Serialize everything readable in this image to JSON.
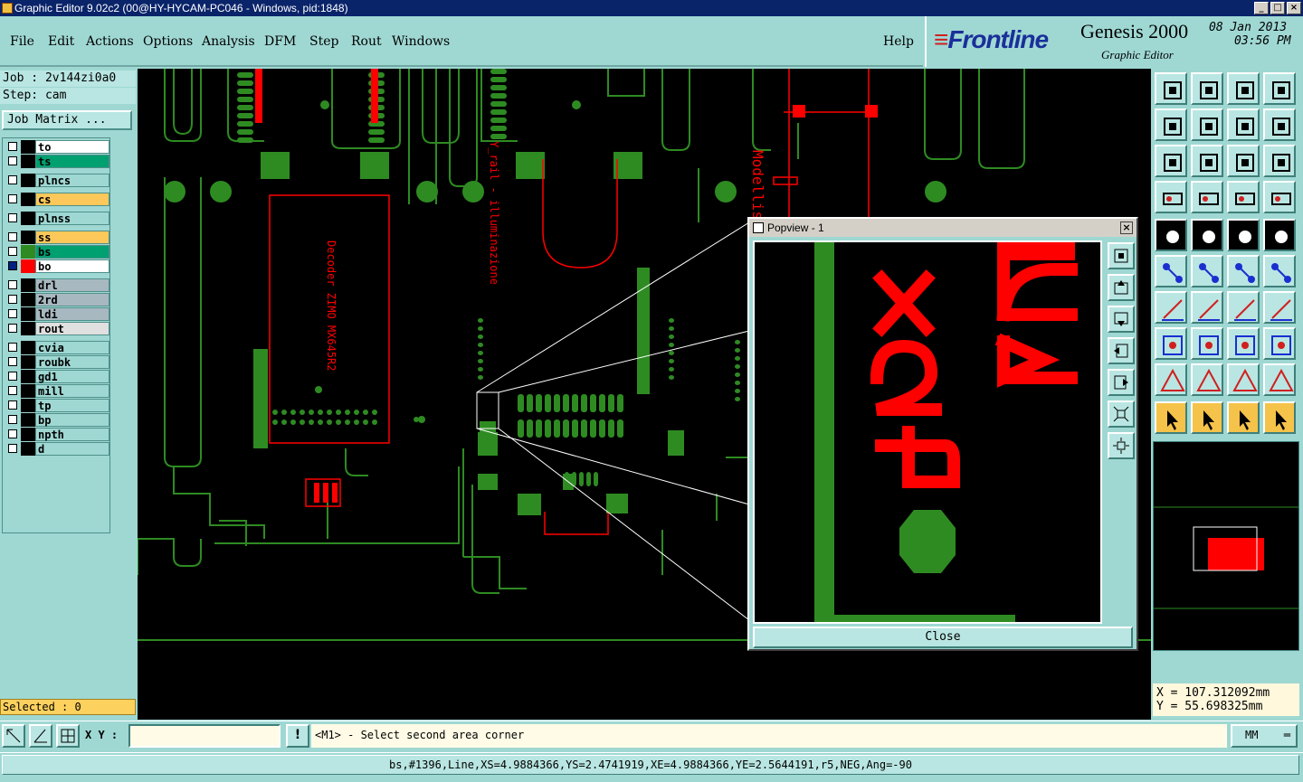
{
  "window": {
    "title": "Graphic Editor 9.02c2 (00@HY-HYCAM-PC046 - Windows, pid:1848)",
    "btn_min": "_",
    "btn_max": "□",
    "btn_close": "×"
  },
  "menu": {
    "items": [
      "File",
      "Edit",
      "Actions",
      "Options",
      "Analysis",
      "DFM",
      "Step",
      "Rout",
      "Windows"
    ],
    "help": "Help"
  },
  "brand": {
    "logo": "Frontline",
    "product": "Genesis 2000",
    "subtitle": "Graphic Editor",
    "date": "08 Jan 2013",
    "time": "03:56 PM"
  },
  "job": {
    "job_line": "Job : 2v144zi0a0",
    "step_line": "Step: cam",
    "matrix_button": "Job Matrix ..."
  },
  "layers": [
    {
      "name": "to",
      "color": "#ffffff",
      "swatch": "#000000",
      "checked": false
    },
    {
      "name": "ts",
      "color": "#00a070",
      "swatch": "#000000",
      "checked": false
    },
    {
      "name": "plncs",
      "color": "#9fd8d3",
      "swatch": "#000000",
      "checked": false
    },
    {
      "name": "cs",
      "color": "#fcc85a",
      "swatch": "#000000",
      "checked": false
    },
    {
      "name": "plnss",
      "color": "#9fd8d3",
      "swatch": "#000000",
      "checked": false
    },
    {
      "name": "ss",
      "color": "#fcc85a",
      "swatch": "#000000",
      "checked": false
    },
    {
      "name": "bs",
      "color": "#00a070",
      "swatch": "#2e8b22",
      "checked": false
    },
    {
      "name": "bo",
      "color": "#ffffff",
      "swatch": "#ff0000",
      "checked": true
    },
    {
      "name": "drl",
      "color": "#a8b8c0",
      "swatch": "#000000",
      "checked": false
    },
    {
      "name": "2rd",
      "color": "#a8b8c0",
      "swatch": "#000000",
      "checked": false
    },
    {
      "name": "ldi",
      "color": "#a8b8c0",
      "swatch": "#000000",
      "checked": false
    },
    {
      "name": "rout",
      "color": "#e0e0e0",
      "swatch": "#000000",
      "checked": false
    },
    {
      "name": "cvia",
      "color": "#9fd8d3",
      "swatch": "#000000",
      "checked": false
    },
    {
      "name": "roubk",
      "color": "#9fd8d3",
      "swatch": "#000000",
      "checked": false
    },
    {
      "name": "gd1",
      "color": "#9fd8d3",
      "swatch": "#000000",
      "checked": false
    },
    {
      "name": "mill",
      "color": "#9fd8d3",
      "swatch": "#000000",
      "checked": false
    },
    {
      "name": "tp",
      "color": "#9fd8d3",
      "swatch": "#000000",
      "checked": false
    },
    {
      "name": "bp",
      "color": "#9fd8d3",
      "swatch": "#000000",
      "checked": false
    },
    {
      "name": "npth",
      "color": "#9fd8d3",
      "swatch": "#000000",
      "checked": false
    },
    {
      "name": "d",
      "color": "#9fd8d3",
      "swatch": "#000000",
      "checked": false
    }
  ],
  "selected_label": "Selected : 0",
  "popview": {
    "title": "Popview - 1",
    "close_label": "Close",
    "close_x": "×"
  },
  "coords": {
    "x": "X  =  107.312092mm",
    "y": "Y  =  55.698325mm"
  },
  "command": {
    "xy_label": "X Y :",
    "xy_value": "",
    "alert": "!",
    "message": "<M1> - Select second area corner",
    "units": "MM"
  },
  "status": "bs,#1396,Line,XS=4.9884366,YS=2.4741919,XE=4.9884366,YE=2.5644191,r5,NEG,Ang=-90",
  "canvas_texts": {
    "decoder": "Decoder ZIMO MX645R2",
    "model": "Modellismo Ferroviario",
    "spacer": "Y_rail - illuminazione"
  },
  "colors": {
    "pcb_line": "#2e8b22",
    "pcb_red": "#ff0000",
    "panel": "#9fd8d3"
  }
}
